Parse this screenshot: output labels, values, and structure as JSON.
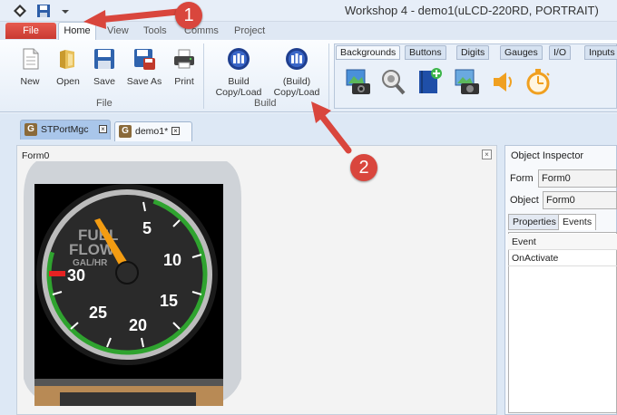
{
  "title_bar": {
    "title": "Workshop 4 - demo1(uLCD-220RD, PORTRAIT)",
    "quick_access": [
      "app-icon",
      "save-icon",
      "dropdown-icon"
    ]
  },
  "ribbon_tabs": {
    "file": "File",
    "home": "Home",
    "view": "View",
    "tools": "Tools",
    "comms": "Comms",
    "project": "Project"
  },
  "file_group": {
    "label": "File",
    "buttons": [
      {
        "label": "New",
        "icon": "new-document-icon"
      },
      {
        "label": "Open",
        "icon": "open-folder-icon"
      },
      {
        "label": "Save",
        "icon": "save-icon"
      },
      {
        "label": "Save As",
        "icon": "save-as-icon"
      },
      {
        "label": "Print",
        "icon": "printer-icon"
      }
    ]
  },
  "build_group": {
    "label": "Build",
    "buttons": [
      {
        "line1": "Build",
        "line2": "Copy/Load",
        "icon": "build-icon"
      },
      {
        "line1": "(Build)",
        "line2": "Copy/Load",
        "icon": "build-copy-icon"
      }
    ]
  },
  "palette": {
    "tabs": [
      "Backgrounds",
      "Buttons",
      "Digits",
      "Gauges",
      "I/O",
      "Inputs"
    ],
    "icons": [
      "image-camera-icon",
      "magnifier-gear-icon",
      "blue-book-plus-icon",
      "image-camera-small-icon",
      "speaker-icon",
      "timer-icon"
    ]
  },
  "doc_tabs": [
    {
      "label": "STPortMgc",
      "icon": "g-icon"
    },
    {
      "label": "demo1*",
      "icon": "g-icon"
    }
  ],
  "form": {
    "label": "Form0",
    "gauge": {
      "text_line1": "FUEL",
      "text_line2": "FLOW",
      "text_line3": "GAL/HR",
      "ticks": [
        "5",
        "10",
        "15",
        "20",
        "25",
        "30"
      ],
      "needle_value": 2,
      "accent": "#2fa32f"
    }
  },
  "inspector": {
    "title": "Object Inspector",
    "form_label": "Form",
    "form_value": "Form0",
    "object_label": "Object",
    "object_value": "Form0",
    "tabs": [
      "Properties",
      "Events"
    ],
    "active_tab": "Events",
    "table_header": "Event",
    "rows": [
      "OnActivate"
    ]
  },
  "annotations": {
    "badge1": "1",
    "badge2": "2",
    "color": "#d9463d"
  }
}
